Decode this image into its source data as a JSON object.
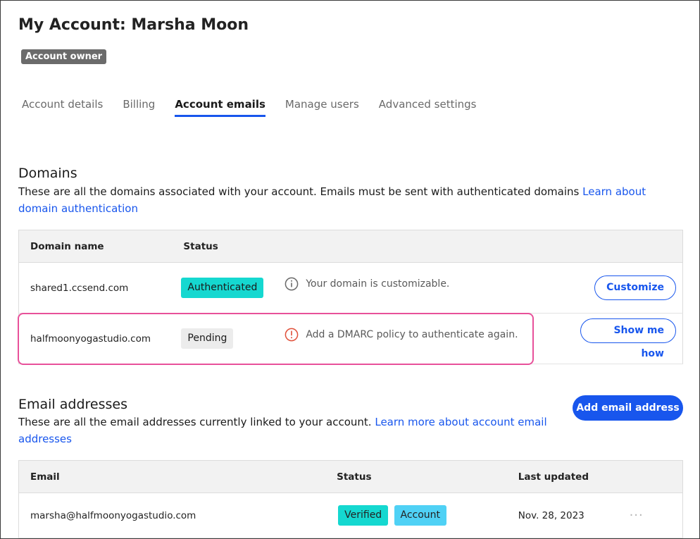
{
  "header": {
    "title": "My Account: Marsha Moon",
    "badge": "Account owner"
  },
  "tabs": [
    {
      "label": "Account details",
      "active": false
    },
    {
      "label": "Billing",
      "active": false
    },
    {
      "label": "Account emails",
      "active": true
    },
    {
      "label": "Manage users",
      "active": false
    },
    {
      "label": "Advanced settings",
      "active": false
    }
  ],
  "domains": {
    "title": "Domains",
    "description": "These are all the domains associated with your account. Emails must be sent with authenticated domains ",
    "link": "Learn about domain authentication",
    "columns": {
      "name": "Domain name",
      "status": "Status"
    },
    "rows": [
      {
        "name": "shared1.ccsend.com",
        "status": "Authenticated",
        "note": "Your domain is customizable.",
        "note_icon": "info-icon",
        "action": "Customize"
      },
      {
        "name": "halfmoonyogastudio.com",
        "status": "Pending",
        "note": "Add a DMARC policy to authenticate again.",
        "note_icon": "warning-icon",
        "action": "Show me how"
      }
    ]
  },
  "emails": {
    "title": "Email addresses",
    "description": "These are all the email addresses currently linked to your account. ",
    "link": "Learn more about account email addresses",
    "add_button": "Add email address",
    "columns": {
      "email": "Email",
      "status": "Status",
      "updated": "Last updated"
    },
    "rows": [
      {
        "email": "marsha@halfmoonyogastudio.com",
        "badges": [
          "Verified",
          "Account"
        ],
        "updated": "Nov. 28, 2023",
        "menu": "···"
      }
    ]
  },
  "colors": {
    "accent": "#1856ed",
    "authenticated": "#15d8d0",
    "account_badge": "#4fd1f5",
    "warning": "#e0503a",
    "highlight": "#e8519a"
  }
}
